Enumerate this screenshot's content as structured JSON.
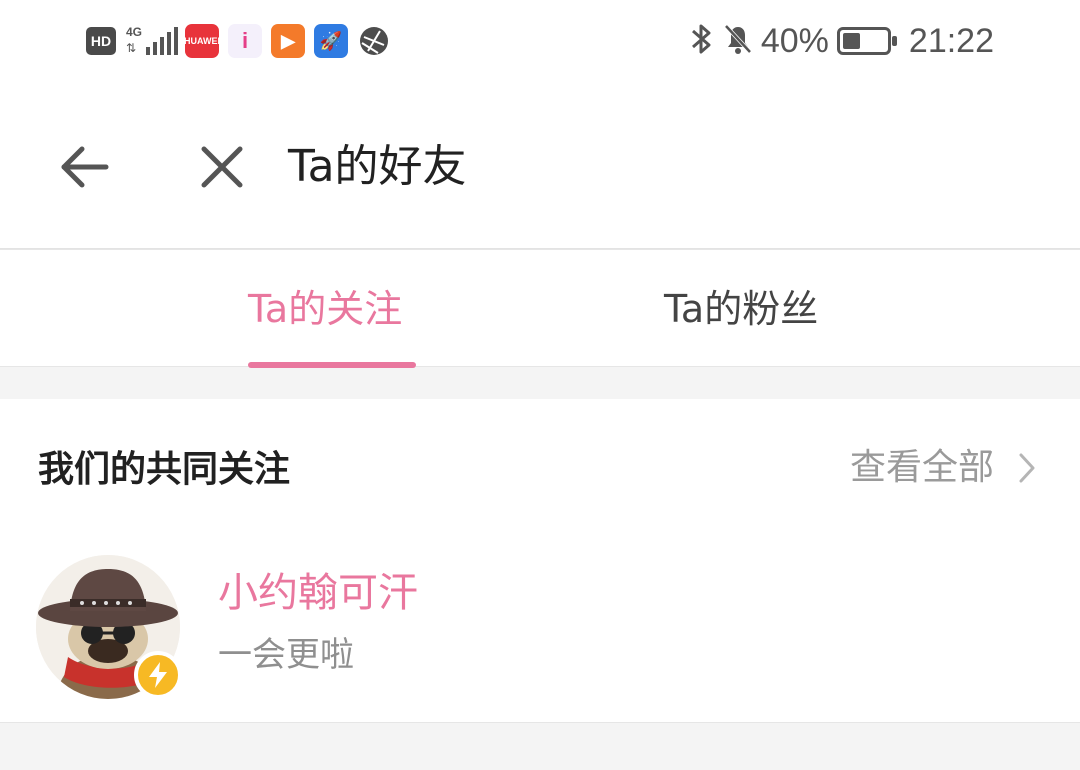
{
  "status_bar": {
    "hd": "HD",
    "network": "4G",
    "apps": [
      {
        "name": "huawei-appgallery",
        "label": "HUAWEI",
        "color": "#e8333b"
      },
      {
        "name": "info-app",
        "label": "i",
        "color": "#f4f0fb"
      },
      {
        "name": "video-app",
        "label": "▶",
        "color": "#f47a2a"
      },
      {
        "name": "rocket-app",
        "label": "🚀",
        "color": "#2f7be2"
      },
      {
        "name": "globe-app",
        "label": "",
        "color": "#4d4d4d"
      }
    ],
    "battery": "40%",
    "battery_level": 0.4,
    "time": "21:22"
  },
  "header": {
    "title": "Ta的好友"
  },
  "tabs": [
    {
      "label": "Ta的关注",
      "active": true
    },
    {
      "label": "Ta的粉丝",
      "active": false
    }
  ],
  "section": {
    "title": "我们的共同关注",
    "view_all": "查看全部"
  },
  "users": [
    {
      "name": "小约翰可汗",
      "description": "一会更啦"
    }
  ],
  "colors": {
    "accent": "#e9779e",
    "badge": "#f7b924"
  }
}
